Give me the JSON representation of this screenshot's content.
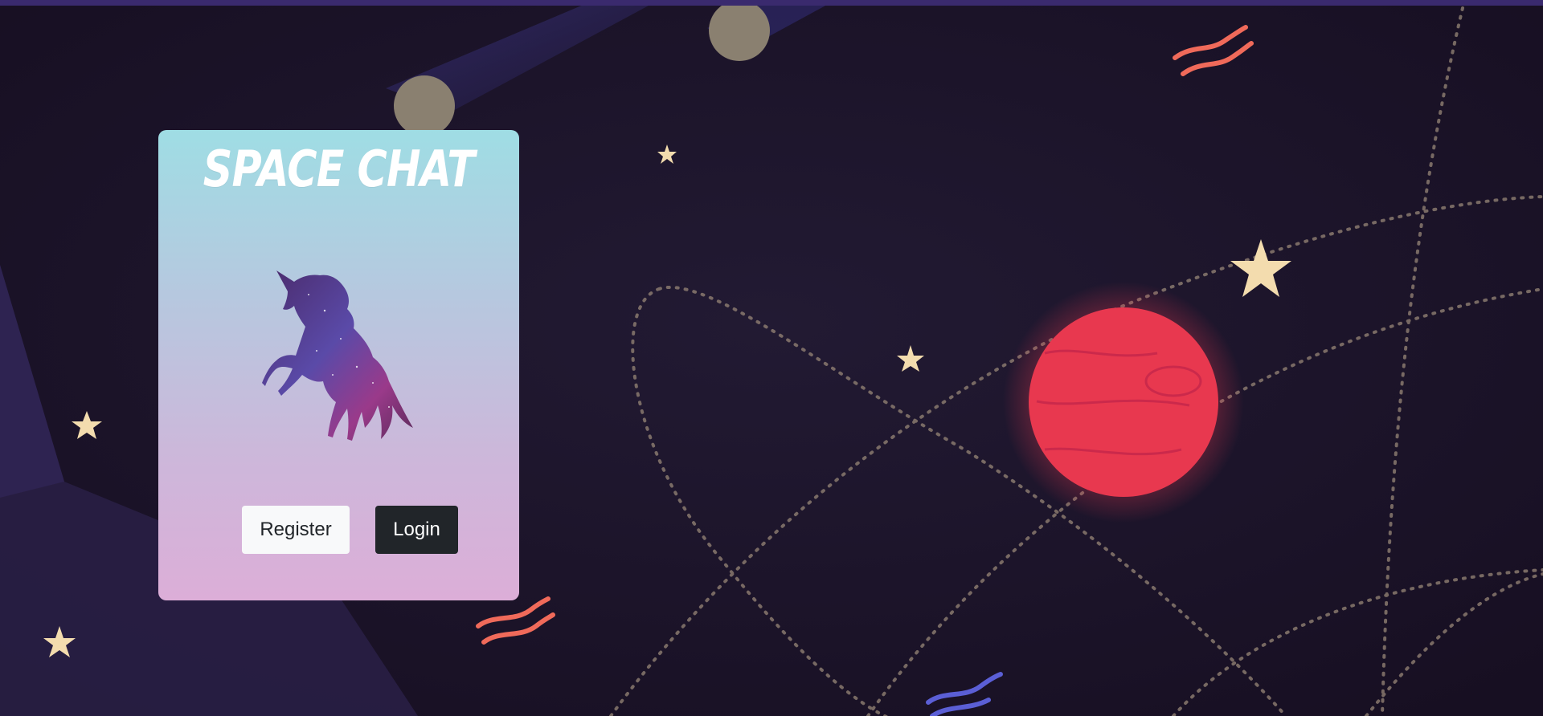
{
  "app": {
    "title": "SPACE CHAT"
  },
  "buttons": {
    "register_label": "Register",
    "login_label": "Login"
  },
  "colors": {
    "topbar": "#3a2a6e",
    "background": "#1c1428",
    "card_top": "#9fdde4",
    "card_bottom": "#dcaed8",
    "planet": "#e8384f",
    "star": "#f3dcae",
    "wave_red": "#f06a5a",
    "wave_blue": "#5b5fd6",
    "register_bg": "#f8f9fa",
    "login_bg": "#212529"
  },
  "icons": {
    "logo": "unicorn-icon"
  }
}
